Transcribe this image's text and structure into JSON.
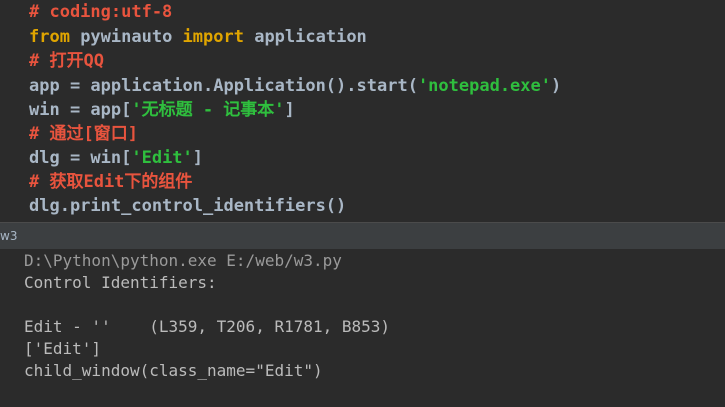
{
  "editor": {
    "lines": [
      {
        "tokens": [
          {
            "t": "# coding:utf-8",
            "k": "comment"
          }
        ]
      },
      {
        "tokens": [
          {
            "t": "from",
            "k": "keyword"
          },
          {
            "t": " pywinauto ",
            "k": "plain"
          },
          {
            "t": "import",
            "k": "keyword"
          },
          {
            "t": " application",
            "k": "plain"
          }
        ]
      },
      {
        "tokens": [
          {
            "t": "# 打开QQ",
            "k": "comment"
          }
        ]
      },
      {
        "tokens": [
          {
            "t": "app = application.Application().start(",
            "k": "plain"
          },
          {
            "t": "'notepad.exe'",
            "k": "string"
          },
          {
            "t": ")",
            "k": "plain"
          }
        ]
      },
      {
        "tokens": [
          {
            "t": "win = app[",
            "k": "plain"
          },
          {
            "t": "'无标题 - 记事本'",
            "k": "string"
          },
          {
            "t": "]",
            "k": "plain"
          }
        ]
      },
      {
        "tokens": [
          {
            "t": "# 通过[窗口]",
            "k": "comment"
          }
        ]
      },
      {
        "tokens": [
          {
            "t": "dlg = win[",
            "k": "plain"
          },
          {
            "t": "'Edit'",
            "k": "string"
          },
          {
            "t": "]",
            "k": "plain"
          }
        ]
      },
      {
        "tokens": [
          {
            "t": "# 获取Edit下的组件",
            "k": "comment"
          }
        ]
      },
      {
        "tokens": [
          {
            "t": "dlg.print_control_identifiers()",
            "k": "plain"
          }
        ]
      }
    ]
  },
  "tool_window": {
    "tab_label": "w3"
  },
  "console": {
    "lines": [
      "D:\\Python\\python.exe E:/web/w3.py",
      "Control Identifiers:",
      "",
      "Edit - ''    (L359, T206, R1781, B853)",
      "['Edit']",
      "child_window(class_name=\"Edit\")"
    ]
  },
  "colors": {
    "background": "#2b2b2b",
    "comment": "#e8543e",
    "keyword": "#e0a500",
    "string": "#2fbf3e",
    "plain": "#a9b7c6",
    "console_text": "#bbbbbb",
    "tool_header": "#3c3f41"
  }
}
